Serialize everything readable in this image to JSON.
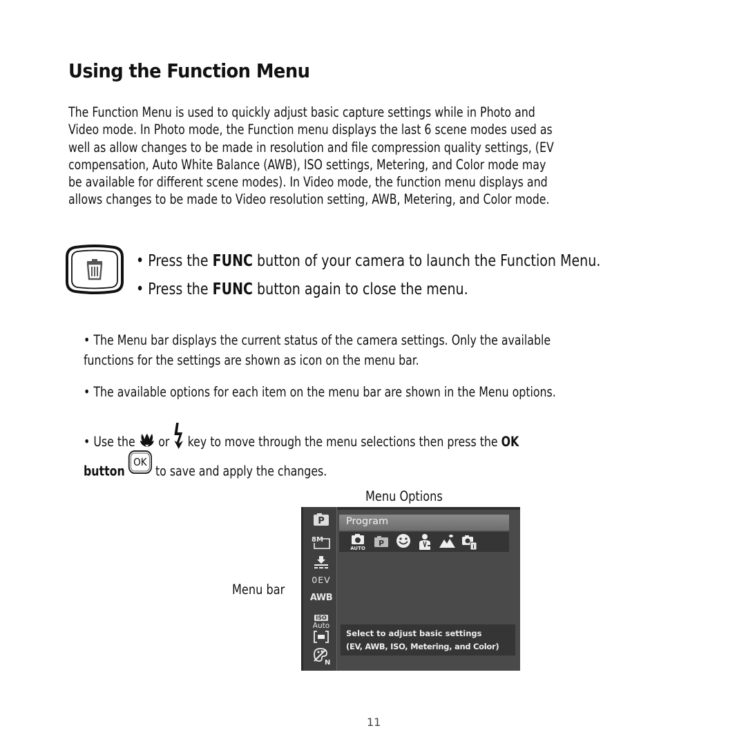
{
  "page": {
    "title": "Using the Function Menu",
    "intro": "The Function Menu is used to quickly adjust basic capture settings while in Photo and Video mode. In Photo mode, the Function menu displays the last 6 scene modes used as well as allow changes to be made in resolution and file compression quality settings, (EV compensation, Auto White Balance (AWB), ISO settings, Metering, and Color mode may be available for different scene modes). In Video mode, the function menu displays and allows changes to be made to Video resolution setting, AWB, Metering, and Color mode.",
    "intro_lines": [
      "The Function Menu is used to quickly adjust basic capture settings while in Photo and",
      "Video mode. In Photo mode, the Function menu displays the last 6 scene modes used as",
      "well as allow changes to be made in resolution and file compression quality settings, (EV",
      "compensation, Auto White Balance (AWB), ISO settings, Metering, and Color mode may",
      "be available for different scene modes). In Video mode, the function menu displays and",
      "allows changes to be made to Video resolution setting, AWB, Metering, and Color mode."
    ],
    "page_number": "11"
  },
  "func_instructions": {
    "button_icon": "trash-icon",
    "line1": {
      "pre": "• Press the ",
      "bold": "FUNC",
      "post": " button of your camera to launch the Function Menu."
    },
    "line2": {
      "pre": "• Press the ",
      "bold": "FUNC",
      "post": " button again to close the menu."
    }
  },
  "bullets": {
    "b1_line1": "• The Menu bar displays the current status of the camera settings.  Only the available",
    "b1_line2": "functions for the settings are shown as icon on the menu bar.",
    "b2": "• The available options for each item on the menu bar are shown in the Menu options.",
    "b3": {
      "pre": "• Use the",
      "icon1": "macro-flower-icon",
      "mid": "or",
      "icon2": "flash-icon",
      "post": "key to move through the menu selections then press the",
      "bold": "OK",
      "line2_bold": "button",
      "ok_icon_label": "OK",
      "line2_post": "to save and apply the changes."
    }
  },
  "figure": {
    "menu_options_label": "Menu Options",
    "menu_bar_label": "Menu bar",
    "menu_bar_items": [
      {
        "icon": "program-mode-icon",
        "label": "P"
      },
      {
        "icon": "resolution-icon",
        "label": "8M"
      },
      {
        "icon": "quality-icon",
        "label": ""
      },
      {
        "icon": "ev-icon",
        "label": "0EV"
      },
      {
        "icon": "awb-icon",
        "label": "AWB"
      },
      {
        "icon": "iso-icon",
        "label": "ISO",
        "sublabel": "Auto"
      },
      {
        "icon": "metering-icon",
        "label": ""
      },
      {
        "icon": "color-mode-icon",
        "label": "N"
      }
    ],
    "selected_option": "Program",
    "options": [
      {
        "icon": "auto-camera-icon",
        "label": "AUTO"
      },
      {
        "icon": "program-icon",
        "label": "P"
      },
      {
        "icon": "smile-icon",
        "label": ""
      },
      {
        "icon": "portrait-icon",
        "label": ""
      },
      {
        "icon": "landscape-icon",
        "label": ""
      },
      {
        "icon": "info-camera-icon",
        "label": ""
      }
    ],
    "hint_line1": "Select to adjust basic settings",
    "hint_line2": "(EV, AWB, ISO, Metering, and Color)"
  }
}
